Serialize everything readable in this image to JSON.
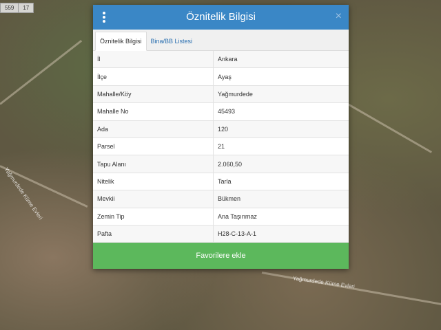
{
  "map": {
    "scale": [
      "559",
      "17"
    ],
    "road_labels": [
      "Yağmurdede Küme Evleri",
      "Yağmurdede Küme Evleri"
    ]
  },
  "dialog": {
    "title": "Öznitelik Bilgisi",
    "close_symbol": "×",
    "tabs": [
      {
        "label": "Öznitelik Bilgisi",
        "active": true
      },
      {
        "label": "Bina/BB Listesi",
        "active": false
      }
    ],
    "rows": [
      {
        "key": "İl",
        "value": "Ankara"
      },
      {
        "key": "İlçe",
        "value": "Ayaş"
      },
      {
        "key": "Mahalle/Köy",
        "value": "Yağmurdede"
      },
      {
        "key": "Mahalle No",
        "value": "45493"
      },
      {
        "key": "Ada",
        "value": "120"
      },
      {
        "key": "Parsel",
        "value": "21"
      },
      {
        "key": "Tapu Alanı",
        "value": "2.060,50"
      },
      {
        "key": "Nitelik",
        "value": "Tarla"
      },
      {
        "key": "Mevkii",
        "value": "Bükmen"
      },
      {
        "key": "Zemin Tip",
        "value": "Ana Taşınmaz"
      },
      {
        "key": "Pafta",
        "value": "H28-C-13-A-1"
      }
    ],
    "favorite_button": "Favorilere ekle"
  },
  "colors": {
    "header": "#3a87c6",
    "button": "#5cb85c"
  }
}
